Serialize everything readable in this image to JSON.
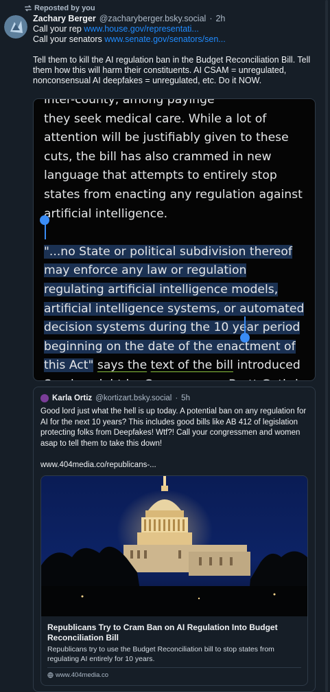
{
  "repost": {
    "label": "Reposted by you",
    "icon": "repost-icon"
  },
  "post": {
    "author_name": "Zachary Berger",
    "author_handle": "@zacharyberger.bsky.social",
    "sep": "·",
    "time": "2h",
    "line1_prefix": "Call your rep",
    "line1_link": "www.house.gov/representati...",
    "line2_prefix": "Call your senators",
    "line2_link": "www.senate.gov/senators/sen...",
    "body": "Tell them to kill the AI regulation ban in the Budget Reconciliation Bill. Tell them how this will harm their constituents. AI CSAM = unregulated, nonconsensual AI deepfakes = unregulated, etc. Do it NOW."
  },
  "screenshot": {
    "top_partial": "inter-county, among payinge",
    "p1": "they seek medical care. While a lot of attention will be justifiably given to these cuts, the bill has also crammed in new language that attempts to entirely stop states from enacting any regulation against artificial intelligence.",
    "quote_selected": "\"...no State or political subdivision thereof may enforce any law or regulation regulating artificial intelligence models, artificial intelligence systems, or automated decision systems during the 10 year period beginning on the date of the enactment of this Act\"",
    "says_the": "says the",
    "text_of_bill": "text of the bill",
    "rest": "introduced Sunday night by Congressman Brett Guthrie of Kentucky, Chairman of the House Committee on Energy"
  },
  "quote": {
    "author_name": "Karla Ortiz",
    "author_handle": "@kortizart.bsky.social",
    "sep": "·",
    "time": "5h",
    "body": "Good lord just what the hell is up today. A potential ban on any regulation for AI for the next 10 years? This includes good bills like AB 412  of legislation protecting folks from Deepfakes! Wtf?! Call your congressmen and women asap to tell them to take this down!",
    "link": "www.404media.co/republicans-..."
  },
  "card": {
    "title": "Republicans Try to Cram Ban on AI Regulation Into Budget Reconciliation Bill",
    "description": "Republicans try to use the Budget Reconciliation bill to stop states from regulating AI entirely for 10 years.",
    "domain": "www.404media.co",
    "image": "capitol-building-night-image",
    "globe_icon": "globe-icon"
  },
  "colors": {
    "background": "#161e27",
    "link": "#208bfe",
    "muted": "#aebbc9",
    "selection": "#1b3152",
    "handle": "#3a8cf5",
    "underline": "#8ac23e"
  }
}
